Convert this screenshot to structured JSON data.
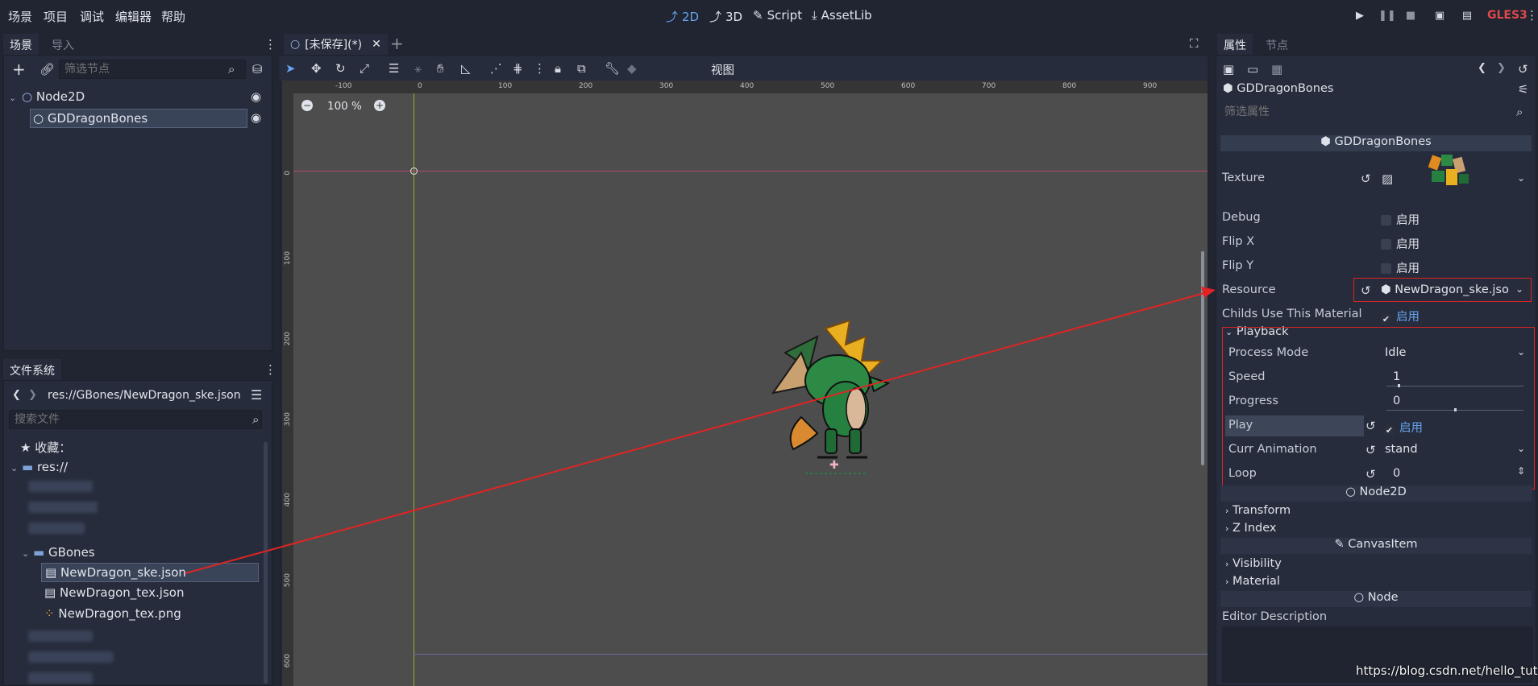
{
  "menubar": [
    "场景",
    "项目",
    "调试",
    "编辑器",
    "帮助"
  ],
  "modes": [
    {
      "label": "2D",
      "active": true
    },
    {
      "label": "3D",
      "active": false
    },
    {
      "label": "Script",
      "active": false
    },
    {
      "label": "AssetLib",
      "active": false
    }
  ],
  "renderer": "GLES3",
  "scene_dock": {
    "tabs": [
      "场景",
      "导入"
    ],
    "filter_placeholder": "筛选节点",
    "nodes": [
      "Node2D",
      "GDDragonBones"
    ]
  },
  "filesystem_dock": {
    "title": "文件系统",
    "path": "res://GBones/NewDragon_ske.json",
    "search_placeholder": "搜索文件",
    "favorites": "收藏：",
    "root": "res://",
    "folder": "GBones",
    "files": [
      "NewDragon_ske.json",
      "NewDragon_tex.json",
      "NewDragon_tex.png"
    ]
  },
  "editor": {
    "tab_label": "[未保存](*)",
    "view_menu": "视图",
    "zoom": "100 %",
    "ruler_h": [
      "-100",
      "0",
      "100",
      "200",
      "300",
      "400",
      "500",
      "600",
      "700",
      "800",
      "900"
    ],
    "ruler_v": [
      "0",
      "100",
      "200",
      "300",
      "400",
      "500",
      "600"
    ]
  },
  "inspector": {
    "tabs": [
      "属性",
      "节点"
    ],
    "object_name": "GDDragonBones",
    "filter_placeholder": "筛选属性",
    "class_section": "GDDragonBones",
    "props": {
      "texture": "Texture",
      "debug": "Debug",
      "flip_x": "Flip X",
      "flip_y": "Flip Y",
      "resource": "Resource",
      "resource_value": "NewDragon_ske.jso",
      "childs_material": "Childs Use This Material",
      "enable": "启用"
    },
    "playback": {
      "title": "Playback",
      "process_mode": "Process Mode",
      "process_mode_value": "Idle",
      "speed": "Speed",
      "speed_value": "1",
      "progress": "Progress",
      "progress_value": "0",
      "play": "Play",
      "curr_animation": "Curr Animation",
      "curr_animation_value": "stand",
      "loop": "Loop",
      "loop_value": "0"
    },
    "node2d_section": "Node2D",
    "transform": "Transform",
    "z_index": "Z Index",
    "canvasitem_section": "CanvasItem",
    "visibility": "Visibility",
    "material": "Material",
    "node_section": "Node",
    "editor_description": "Editor Description"
  },
  "watermark": "https://blog.csdn.net/hello_tute",
  "colors": {
    "accent": "#66a3f0",
    "annotation": "#e02424",
    "renderer": "#e0494a"
  }
}
